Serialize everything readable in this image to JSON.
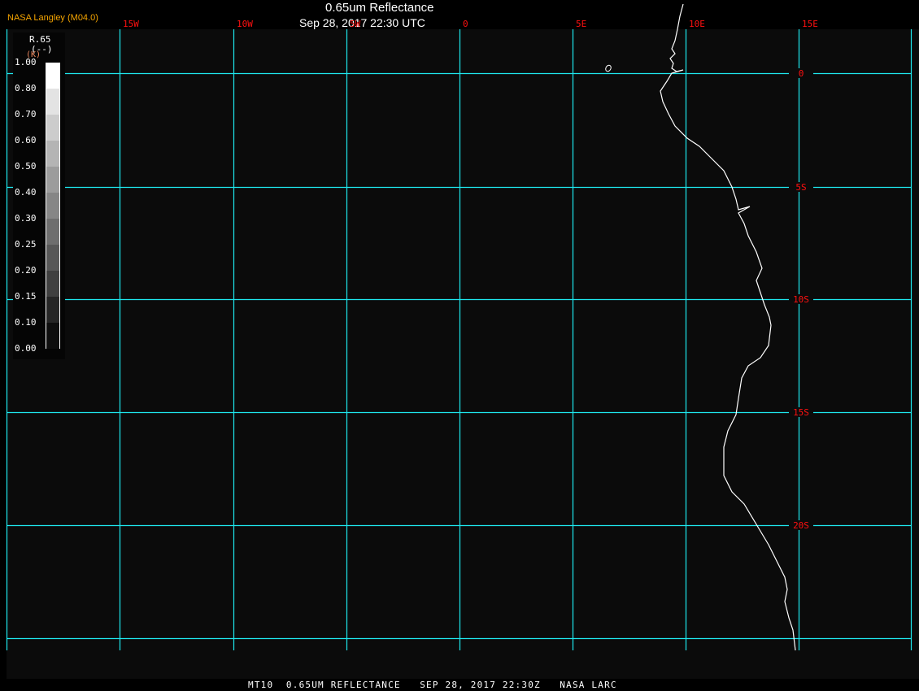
{
  "header": {
    "title": "0.65um Reflectance",
    "subtitle": "Sep 28, 2017 22:30 UTC",
    "brand": "NASA Langley (M04.0)"
  },
  "legend": {
    "variable": "R.65",
    "unit": "(--)",
    "unit_alt": "(K)",
    "ticks": [
      "1.00",
      "0.80",
      "0.70",
      "0.60",
      "0.50",
      "0.40",
      "0.30",
      "0.25",
      "0.20",
      "0.15",
      "0.10",
      "0.00"
    ],
    "colors": [
      "#ffffff",
      "#e3e3e3",
      "#cccccc",
      "#b4b4b4",
      "#9c9c9c",
      "#868686",
      "#6e6e6e",
      "#575757",
      "#404040",
      "#262626",
      "#0e0e0e"
    ]
  },
  "map": {
    "longitude_labels": [
      "15W",
      "10W",
      "5W",
      "0",
      "5E",
      "10E",
      "15E"
    ],
    "latitude_labels": [
      "0",
      "5S",
      "10S",
      "15S",
      "20S"
    ],
    "grid_color": "#1ee8ee",
    "label_color": "#ff1010",
    "coastline_color": "#ffffff"
  },
  "footer": {
    "caption": "MT10  0.65UM REFLECTANCE   SEP 28, 2017 22:30Z   NASA LARC"
  }
}
